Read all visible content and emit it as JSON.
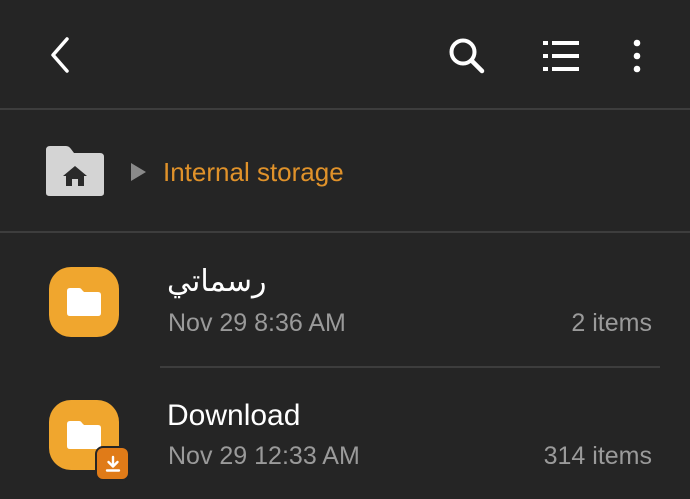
{
  "toolbar": {
    "back_icon": "chevron-left-icon",
    "search_icon": "search-icon",
    "list_view_icon": "list-view-icon",
    "more_icon": "more-vertical-icon"
  },
  "breadcrumb": {
    "home_icon": "home-folder-icon",
    "separator_icon": "play-arrow-icon",
    "current_label": "Internal storage"
  },
  "files": [
    {
      "name": "رسماتي",
      "date": "Nov 29 8:36 AM",
      "count": "2 items",
      "icon": "folder-icon"
    },
    {
      "name": "Download",
      "date": "Nov 29 12:33 AM",
      "count": "314 items",
      "icon": "folder-icon",
      "badge_icon": "download-icon"
    }
  ],
  "colors": {
    "background": "#252525",
    "accent": "#e0922a",
    "folder": "#f0a62e",
    "secondary_text": "#9a9a9a",
    "divider": "#3d3d3d"
  }
}
